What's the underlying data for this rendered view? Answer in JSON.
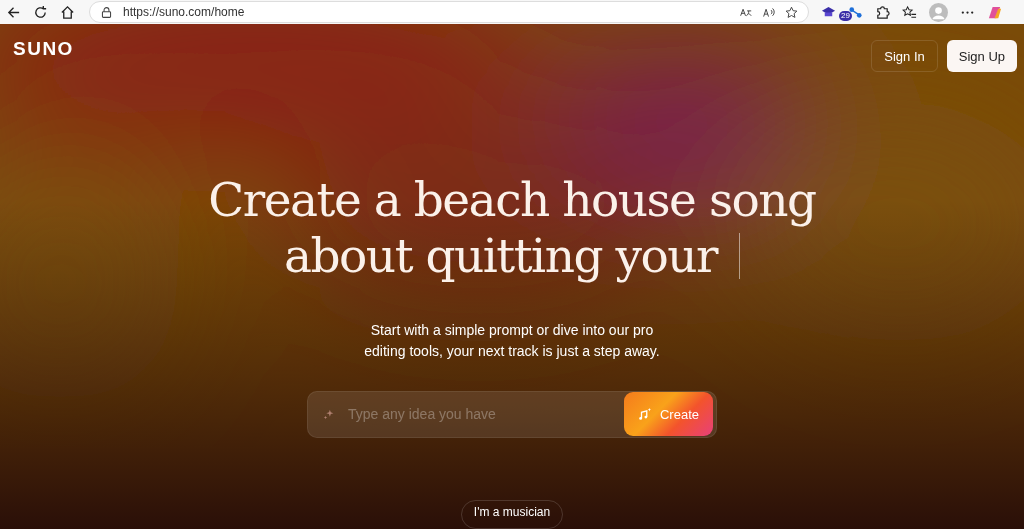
{
  "browser": {
    "url": "https://suno.com/home",
    "extension_badge": "29"
  },
  "header": {
    "logo": "SUNO",
    "buttons": [
      {
        "label": "Sign In",
        "kind": "ghost"
      },
      {
        "label": "Sign Up",
        "kind": "solid"
      }
    ]
  },
  "hero": {
    "title_lines": [
      "Create a beach house song",
      "about quitting your"
    ],
    "subtitle_lines": [
      "Start with a simple prompt or dive into our pro",
      "editing tools, your next track is just a step away."
    ]
  },
  "prompt": {
    "placeholder": "Type any idea you have",
    "button": "Create"
  },
  "secondary_button": "I'm a musician"
}
